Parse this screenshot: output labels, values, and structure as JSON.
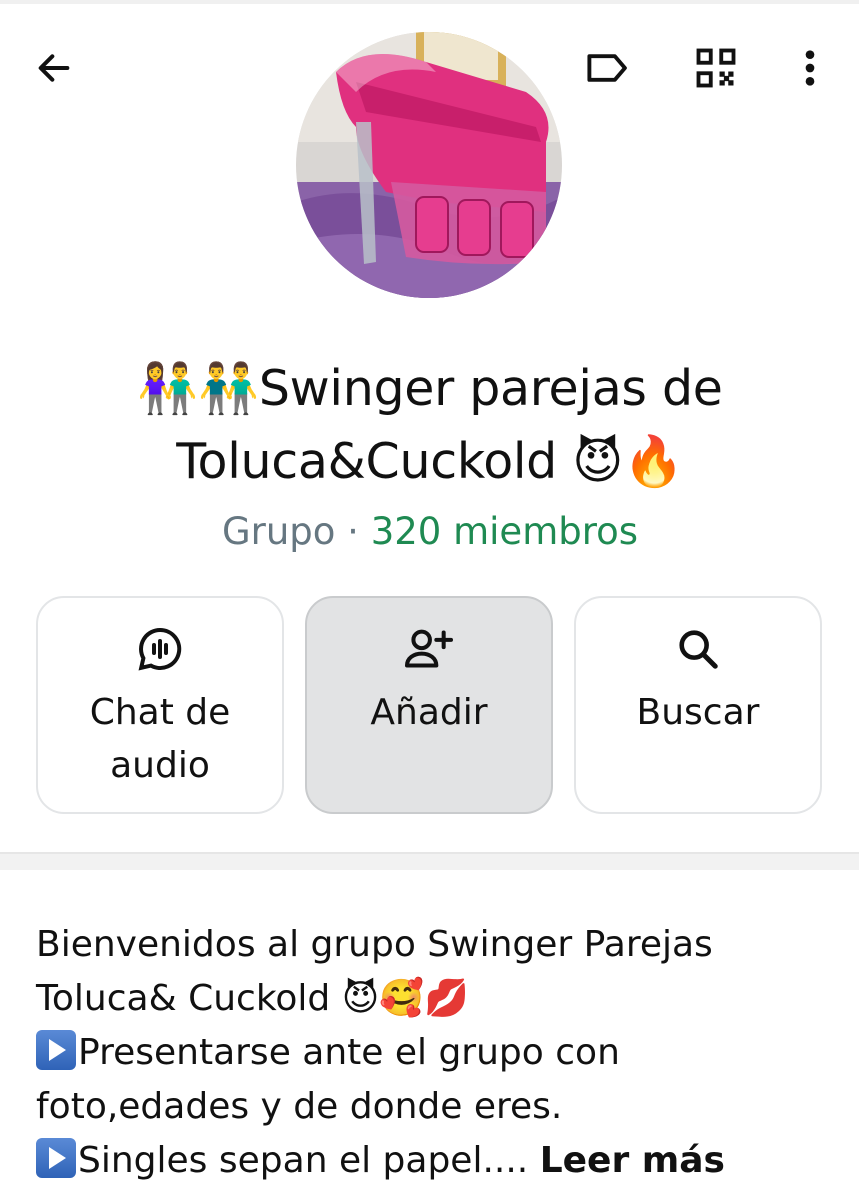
{
  "header": {
    "back_icon": "arrow-left-icon",
    "label_icon": "label-tag-icon",
    "qr_icon": "qr-code-icon",
    "menu_icon": "more-vertical-icon"
  },
  "group": {
    "title_line1": "👫👬Swinger parejas de",
    "title_line2": "Toluca&Cuckold 😈🔥",
    "kind": "Grupo",
    "separator": " · ",
    "members": "320 miembros",
    "members_color": "#1f8a52"
  },
  "actions": [
    {
      "label_line1": "Chat de",
      "label_line2": "audio",
      "icon": "audio-chat-icon"
    },
    {
      "label": "Añadir",
      "icon": "add-person-icon"
    },
    {
      "label": "Buscar",
      "icon": "search-icon"
    }
  ],
  "description": {
    "line1": "Bienvenidos al grupo Swinger Parejas",
    "line2": "Toluca& Cuckold 😈🥰💋",
    "line3": "Presentarse ante el grupo con",
    "line4": "foto,edades y de donde eres.",
    "line5": "Singles sepan el papel....",
    "read_more": "Leer más"
  }
}
